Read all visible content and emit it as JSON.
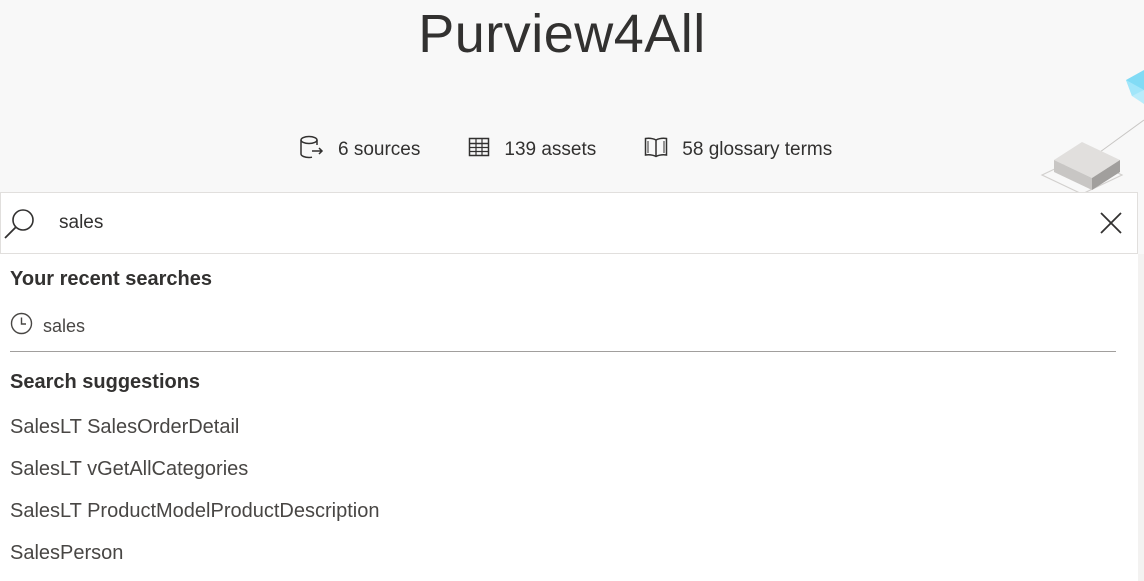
{
  "header": {
    "title": "Purview4All"
  },
  "stats": [
    {
      "icon": "data-source-icon",
      "label": "6 sources"
    },
    {
      "icon": "table-icon",
      "label": "139 assets"
    },
    {
      "icon": "book-icon",
      "label": "58 glossary terms"
    }
  ],
  "search": {
    "value": "sales",
    "placeholder": ""
  },
  "recent": {
    "heading": "Your recent searches",
    "items": [
      "sales"
    ]
  },
  "suggestions": {
    "heading": "Search suggestions",
    "items": [
      "SalesLT SalesOrderDetail",
      "SalesLT vGetAllCategories",
      "SalesLT ProductModelProductDescription",
      "SalesPerson"
    ]
  },
  "colors": {
    "background": "#f8f8f8",
    "text": "#323130",
    "accent": "#5ad2f4"
  }
}
